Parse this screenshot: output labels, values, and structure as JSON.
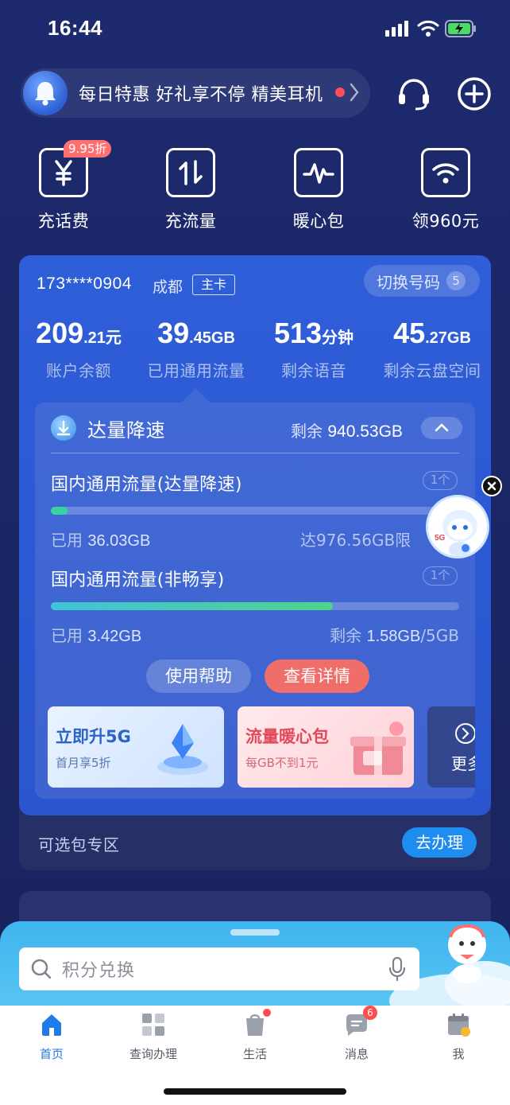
{
  "status_bar": {
    "time": "16:44"
  },
  "marquee": {
    "text": "每日特惠 好礼享不停 精美耳机"
  },
  "quick_actions": [
    {
      "label": "充话费",
      "icon": "yuan-icon",
      "badge": "9.95折"
    },
    {
      "label": "充流量",
      "icon": "transfer-arrows-icon"
    },
    {
      "label": "暖心包",
      "icon": "pulse-icon"
    },
    {
      "label": "领960元",
      "icon": "wifi-icon"
    }
  ],
  "account": {
    "phone": "173****0904",
    "city": "成都",
    "card_tag": "主卡",
    "switch_label": "切换号码",
    "switch_count": "5"
  },
  "stats": [
    {
      "big": "209",
      "small": ".21元",
      "label": "账户余额"
    },
    {
      "big": "39",
      "small": ".45GB",
      "label": "已用通用流量"
    },
    {
      "big": "513",
      "small": "分钟",
      "label": "剩余语音"
    },
    {
      "big": "45",
      "small": ".27GB",
      "label": "剩余云盘空间"
    }
  ],
  "plan": {
    "title": "达量降速",
    "remain_label": "剩余",
    "remain_value": "940.53GB",
    "rows": [
      {
        "title": "国内通用流量(达量降速)",
        "count": "1个",
        "used_label": "已用",
        "used_value": "36.03GB",
        "right_text": "达976.56GB限",
        "fill_fraction": 0.04,
        "fill_color": "#38d39f"
      },
      {
        "title": "国内通用流量(非畅享)",
        "count": "1个",
        "used_label": "已用",
        "used_value": "3.42GB",
        "right_label": "剩余",
        "right_value": "1.58GB",
        "right_total": "/5GB",
        "fill_fraction": 0.69,
        "fill_color": "#3fc4d8"
      }
    ],
    "help_button": "使用帮助",
    "detail_button": "查看详情"
  },
  "promos": [
    {
      "title": "立即升5G",
      "subtitle": "首月享5折"
    },
    {
      "title": "流量暖心包",
      "subtitle": "每GB不到1元"
    },
    {
      "title": "更多"
    }
  ],
  "optional": {
    "label": "可选包专区",
    "button": "去办理"
  },
  "bottom_search": {
    "placeholder": "积分兑换"
  },
  "tabs": [
    {
      "label": "首页",
      "active": true
    },
    {
      "label": "查询办理"
    },
    {
      "label": "生活",
      "dot": true
    },
    {
      "label": "消息",
      "badge": "6"
    },
    {
      "label": "我"
    }
  ],
  "colors": {
    "background": "#1d2a6e",
    "card": "#2e5ed8",
    "accent_blue": "#1f8df0",
    "accent_red": "#ef6e6a"
  }
}
